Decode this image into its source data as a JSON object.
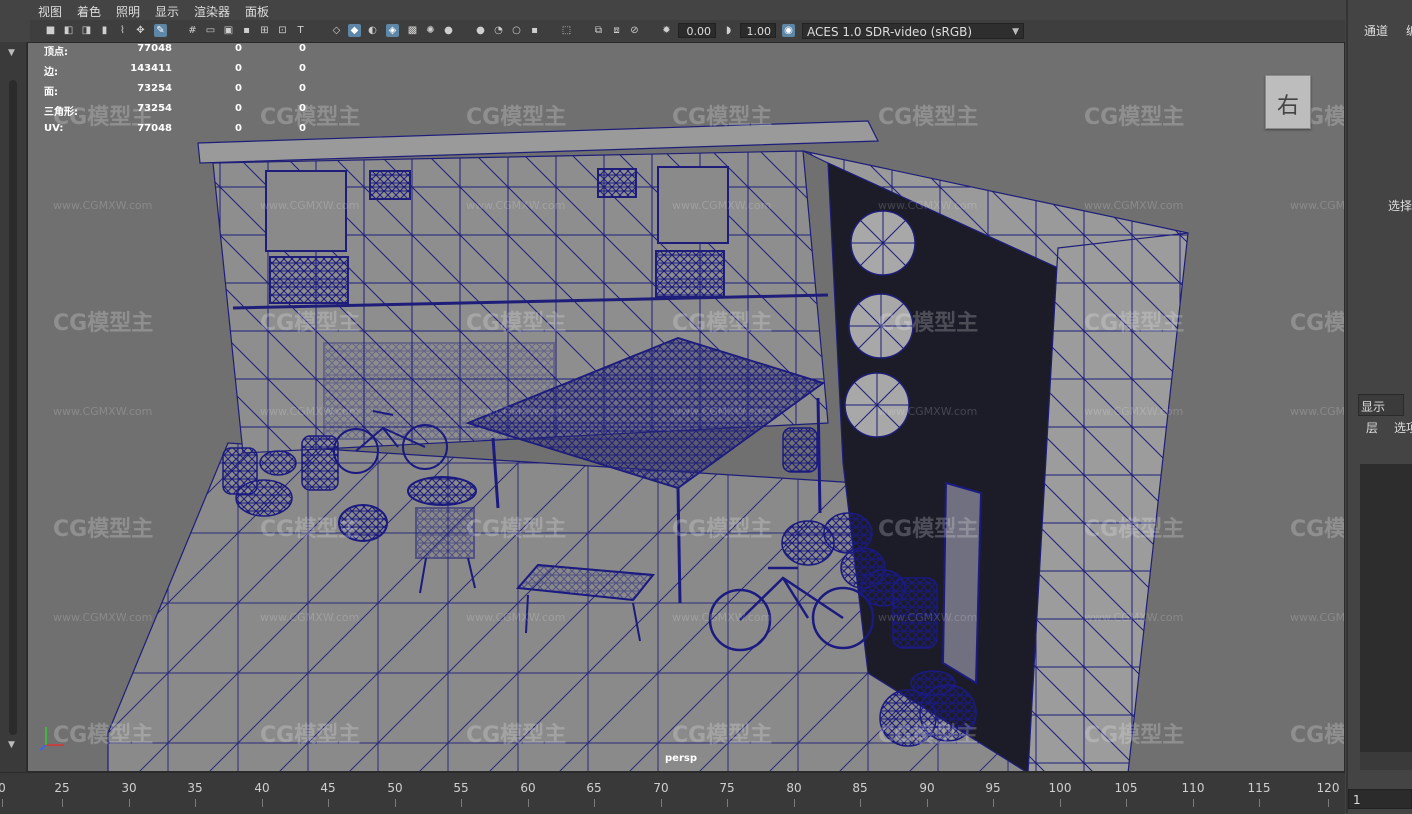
{
  "menu": [
    "视图",
    "着色",
    "照明",
    "显示",
    "渲染器",
    "面板"
  ],
  "toolbar": {
    "exposure_value": "0.00",
    "gamma_value": "1.00",
    "color_management": "ACES 1.0 SDR-video (sRGB)"
  },
  "hud": {
    "rows": [
      {
        "label": "顶点:",
        "values": [
          "77048",
          "0",
          "0"
        ]
      },
      {
        "label": "边:",
        "values": [
          "143411",
          "0",
          "0"
        ]
      },
      {
        "label": "面:",
        "values": [
          "73254",
          "0",
          "0"
        ]
      },
      {
        "label": "三角形:",
        "values": [
          "73254",
          "0",
          "0"
        ]
      },
      {
        "label": "UV:",
        "values": [
          "77048",
          "0",
          "0"
        ]
      }
    ]
  },
  "viewport": {
    "camera": "persp",
    "viewcube_face": "右",
    "watermark": "CG模型主",
    "watermark_url": "www.CGMXW.com"
  },
  "right_panel": {
    "tab_channels": "通道",
    "tab_edit": "编",
    "select_label": "选择",
    "display_tab": "显示",
    "layers_label": "层",
    "options_label": "选项"
  },
  "timeline": {
    "ticks": [
      "0",
      "25",
      "30",
      "35",
      "40",
      "45",
      "50",
      "55",
      "60",
      "65",
      "70",
      "75",
      "80",
      "85",
      "90",
      "95",
      "100",
      "105",
      "110",
      "115",
      "120"
    ],
    "current_frame": "1"
  },
  "colors": {
    "wire": "#1a1a7a",
    "viewport_bg": "#707070",
    "dark_face": "#1c1c28",
    "highlight": "#5d86a7"
  }
}
